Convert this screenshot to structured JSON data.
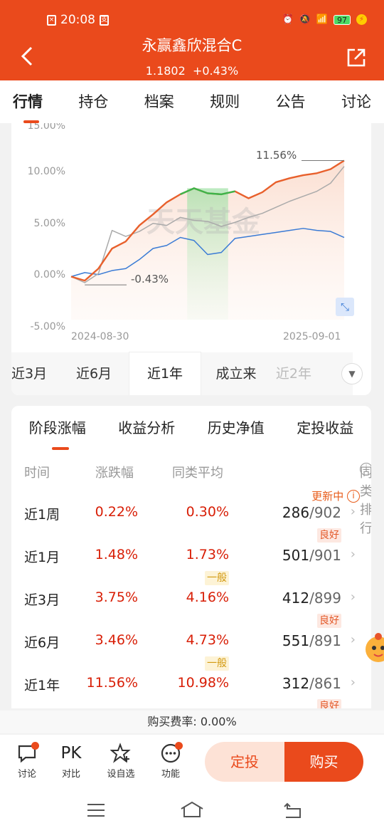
{
  "status": {
    "time": "20:08",
    "battery": "97"
  },
  "header": {
    "title": "永赢鑫欣混合C",
    "nav": "1.1802",
    "change": "+0.43%"
  },
  "tabs": [
    "行情",
    "持仓",
    "档案",
    "规则",
    "公告",
    "讨论"
  ],
  "chart": {
    "watermark": "天天基金",
    "y_ticks": [
      "15.00%",
      "10.00%",
      "5.00%",
      "0.00%",
      "-5.00%"
    ],
    "x_start": "2024-08-30",
    "x_end": "2025-09-01",
    "max_label": "11.56%",
    "min_label": "-0.43%"
  },
  "chart_data": {
    "type": "line",
    "x_range": [
      "2024-08-30",
      "2025-09-01"
    ],
    "ylim": [
      -5,
      15
    ],
    "series": [
      {
        "color": "#e8602c",
        "values": [
          0,
          -0.4,
          0.8,
          2.8,
          3.5,
          5.1,
          6.2,
          7.4,
          8.2,
          8.8,
          8.3,
          8.2,
          8.5,
          7.8,
          8.4,
          9.4,
          9.8,
          10.1,
          10.3,
          10.7,
          11.56
        ]
      },
      {
        "color": "#aaaaaa",
        "values": [
          0,
          -0.6,
          0.3,
          4.6,
          4.0,
          4.5,
          5.3,
          5.1,
          5.9,
          5.6,
          5.5,
          5.0,
          5.4,
          5.9,
          6.3,
          6.9,
          7.5,
          8.0,
          8.5,
          9.3,
          10.98
        ]
      },
      {
        "color": "#3a7bd5",
        "values": [
          0,
          0.4,
          0.2,
          0.6,
          0.8,
          1.7,
          2.8,
          3.1,
          3.9,
          3.6,
          2.2,
          2.4,
          3.8,
          4.0,
          4.2,
          4.4,
          4.6,
          4.8,
          4.6,
          4.5,
          3.9
        ]
      }
    ]
  },
  "periods": [
    "近3月",
    "近6月",
    "近1年",
    "成立来",
    "近2年"
  ],
  "active_period": "近1年",
  "subtabs": [
    "阶段涨幅",
    "收益分析",
    "历史净值",
    "定投收益"
  ],
  "table": {
    "headers": {
      "time": "时间",
      "change": "涨跌幅",
      "avg": "同类平均",
      "rank": "同类排行"
    },
    "updating": "更新中",
    "rows": [
      {
        "period": "近1周",
        "change": "0.22%",
        "avg": "0.30%",
        "rank": "286",
        "total": "/902",
        "level": "良好",
        "level_type": "good"
      },
      {
        "period": "近1月",
        "change": "1.48%",
        "avg": "1.73%",
        "rank": "501",
        "total": "/901",
        "level": "一般",
        "level_type": "avg"
      },
      {
        "period": "近3月",
        "change": "3.75%",
        "avg": "4.16%",
        "rank": "412",
        "total": "/899",
        "level": "良好",
        "level_type": "good"
      },
      {
        "period": "近6月",
        "change": "3.46%",
        "avg": "4.73%",
        "rank": "551",
        "total": "/891",
        "level": "一般",
        "level_type": "avg"
      },
      {
        "period": "近1年",
        "change": "11.56%",
        "avg": "10.98%",
        "rank": "312",
        "total": "/861",
        "level": "良好",
        "level_type": "good"
      }
    ]
  },
  "fee": "购买费率: 0.00%",
  "bottom": {
    "discuss": "讨论",
    "pk_icon": "PK",
    "compare": "对比",
    "watch": "设自选",
    "func": "功能",
    "dingtou": "定投",
    "buy": "购买"
  }
}
